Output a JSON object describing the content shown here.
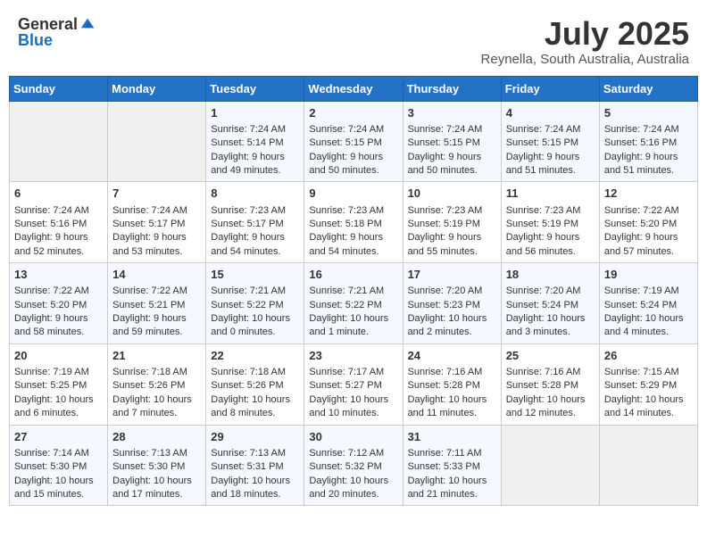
{
  "header": {
    "logo_general": "General",
    "logo_blue": "Blue",
    "title": "July 2025",
    "subtitle": "Reynella, South Australia, Australia"
  },
  "weekdays": [
    "Sunday",
    "Monday",
    "Tuesday",
    "Wednesday",
    "Thursday",
    "Friday",
    "Saturday"
  ],
  "weeks": [
    [
      {
        "day": "",
        "sunrise": "",
        "sunset": "",
        "daylight": ""
      },
      {
        "day": "",
        "sunrise": "",
        "sunset": "",
        "daylight": ""
      },
      {
        "day": "1",
        "sunrise": "Sunrise: 7:24 AM",
        "sunset": "Sunset: 5:14 PM",
        "daylight": "Daylight: 9 hours and 49 minutes."
      },
      {
        "day": "2",
        "sunrise": "Sunrise: 7:24 AM",
        "sunset": "Sunset: 5:15 PM",
        "daylight": "Daylight: 9 hours and 50 minutes."
      },
      {
        "day": "3",
        "sunrise": "Sunrise: 7:24 AM",
        "sunset": "Sunset: 5:15 PM",
        "daylight": "Daylight: 9 hours and 50 minutes."
      },
      {
        "day": "4",
        "sunrise": "Sunrise: 7:24 AM",
        "sunset": "Sunset: 5:15 PM",
        "daylight": "Daylight: 9 hours and 51 minutes."
      },
      {
        "day": "5",
        "sunrise": "Sunrise: 7:24 AM",
        "sunset": "Sunset: 5:16 PM",
        "daylight": "Daylight: 9 hours and 51 minutes."
      }
    ],
    [
      {
        "day": "6",
        "sunrise": "Sunrise: 7:24 AM",
        "sunset": "Sunset: 5:16 PM",
        "daylight": "Daylight: 9 hours and 52 minutes."
      },
      {
        "day": "7",
        "sunrise": "Sunrise: 7:24 AM",
        "sunset": "Sunset: 5:17 PM",
        "daylight": "Daylight: 9 hours and 53 minutes."
      },
      {
        "day": "8",
        "sunrise": "Sunrise: 7:23 AM",
        "sunset": "Sunset: 5:17 PM",
        "daylight": "Daylight: 9 hours and 54 minutes."
      },
      {
        "day": "9",
        "sunrise": "Sunrise: 7:23 AM",
        "sunset": "Sunset: 5:18 PM",
        "daylight": "Daylight: 9 hours and 54 minutes."
      },
      {
        "day": "10",
        "sunrise": "Sunrise: 7:23 AM",
        "sunset": "Sunset: 5:19 PM",
        "daylight": "Daylight: 9 hours and 55 minutes."
      },
      {
        "day": "11",
        "sunrise": "Sunrise: 7:23 AM",
        "sunset": "Sunset: 5:19 PM",
        "daylight": "Daylight: 9 hours and 56 minutes."
      },
      {
        "day": "12",
        "sunrise": "Sunrise: 7:22 AM",
        "sunset": "Sunset: 5:20 PM",
        "daylight": "Daylight: 9 hours and 57 minutes."
      }
    ],
    [
      {
        "day": "13",
        "sunrise": "Sunrise: 7:22 AM",
        "sunset": "Sunset: 5:20 PM",
        "daylight": "Daylight: 9 hours and 58 minutes."
      },
      {
        "day": "14",
        "sunrise": "Sunrise: 7:22 AM",
        "sunset": "Sunset: 5:21 PM",
        "daylight": "Daylight: 9 hours and 59 minutes."
      },
      {
        "day": "15",
        "sunrise": "Sunrise: 7:21 AM",
        "sunset": "Sunset: 5:22 PM",
        "daylight": "Daylight: 10 hours and 0 minutes."
      },
      {
        "day": "16",
        "sunrise": "Sunrise: 7:21 AM",
        "sunset": "Sunset: 5:22 PM",
        "daylight": "Daylight: 10 hours and 1 minute."
      },
      {
        "day": "17",
        "sunrise": "Sunrise: 7:20 AM",
        "sunset": "Sunset: 5:23 PM",
        "daylight": "Daylight: 10 hours and 2 minutes."
      },
      {
        "day": "18",
        "sunrise": "Sunrise: 7:20 AM",
        "sunset": "Sunset: 5:24 PM",
        "daylight": "Daylight: 10 hours and 3 minutes."
      },
      {
        "day": "19",
        "sunrise": "Sunrise: 7:19 AM",
        "sunset": "Sunset: 5:24 PM",
        "daylight": "Daylight: 10 hours and 4 minutes."
      }
    ],
    [
      {
        "day": "20",
        "sunrise": "Sunrise: 7:19 AM",
        "sunset": "Sunset: 5:25 PM",
        "daylight": "Daylight: 10 hours and 6 minutes."
      },
      {
        "day": "21",
        "sunrise": "Sunrise: 7:18 AM",
        "sunset": "Sunset: 5:26 PM",
        "daylight": "Daylight: 10 hours and 7 minutes."
      },
      {
        "day": "22",
        "sunrise": "Sunrise: 7:18 AM",
        "sunset": "Sunset: 5:26 PM",
        "daylight": "Daylight: 10 hours and 8 minutes."
      },
      {
        "day": "23",
        "sunrise": "Sunrise: 7:17 AM",
        "sunset": "Sunset: 5:27 PM",
        "daylight": "Daylight: 10 hours and 10 minutes."
      },
      {
        "day": "24",
        "sunrise": "Sunrise: 7:16 AM",
        "sunset": "Sunset: 5:28 PM",
        "daylight": "Daylight: 10 hours and 11 minutes."
      },
      {
        "day": "25",
        "sunrise": "Sunrise: 7:16 AM",
        "sunset": "Sunset: 5:28 PM",
        "daylight": "Daylight: 10 hours and 12 minutes."
      },
      {
        "day": "26",
        "sunrise": "Sunrise: 7:15 AM",
        "sunset": "Sunset: 5:29 PM",
        "daylight": "Daylight: 10 hours and 14 minutes."
      }
    ],
    [
      {
        "day": "27",
        "sunrise": "Sunrise: 7:14 AM",
        "sunset": "Sunset: 5:30 PM",
        "daylight": "Daylight: 10 hours and 15 minutes."
      },
      {
        "day": "28",
        "sunrise": "Sunrise: 7:13 AM",
        "sunset": "Sunset: 5:30 PM",
        "daylight": "Daylight: 10 hours and 17 minutes."
      },
      {
        "day": "29",
        "sunrise": "Sunrise: 7:13 AM",
        "sunset": "Sunset: 5:31 PM",
        "daylight": "Daylight: 10 hours and 18 minutes."
      },
      {
        "day": "30",
        "sunrise": "Sunrise: 7:12 AM",
        "sunset": "Sunset: 5:32 PM",
        "daylight": "Daylight: 10 hours and 20 minutes."
      },
      {
        "day": "31",
        "sunrise": "Sunrise: 7:11 AM",
        "sunset": "Sunset: 5:33 PM",
        "daylight": "Daylight: 10 hours and 21 minutes."
      },
      {
        "day": "",
        "sunrise": "",
        "sunset": "",
        "daylight": ""
      },
      {
        "day": "",
        "sunrise": "",
        "sunset": "",
        "daylight": ""
      }
    ]
  ]
}
